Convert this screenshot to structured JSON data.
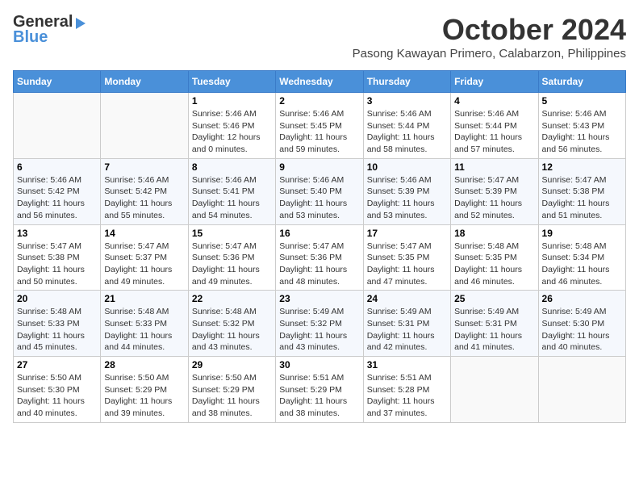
{
  "header": {
    "logo_general": "General",
    "logo_blue": "Blue",
    "month": "October 2024",
    "location": "Pasong Kawayan Primero, Calabarzon, Philippines"
  },
  "days_of_week": [
    "Sunday",
    "Monday",
    "Tuesday",
    "Wednesday",
    "Thursday",
    "Friday",
    "Saturday"
  ],
  "weeks": [
    [
      {
        "day": "",
        "info": ""
      },
      {
        "day": "",
        "info": ""
      },
      {
        "day": "1",
        "info": "Sunrise: 5:46 AM\nSunset: 5:46 PM\nDaylight: 12 hours\nand 0 minutes."
      },
      {
        "day": "2",
        "info": "Sunrise: 5:46 AM\nSunset: 5:45 PM\nDaylight: 11 hours\nand 59 minutes."
      },
      {
        "day": "3",
        "info": "Sunrise: 5:46 AM\nSunset: 5:44 PM\nDaylight: 11 hours\nand 58 minutes."
      },
      {
        "day": "4",
        "info": "Sunrise: 5:46 AM\nSunset: 5:44 PM\nDaylight: 11 hours\nand 57 minutes."
      },
      {
        "day": "5",
        "info": "Sunrise: 5:46 AM\nSunset: 5:43 PM\nDaylight: 11 hours\nand 56 minutes."
      }
    ],
    [
      {
        "day": "6",
        "info": "Sunrise: 5:46 AM\nSunset: 5:42 PM\nDaylight: 11 hours\nand 56 minutes."
      },
      {
        "day": "7",
        "info": "Sunrise: 5:46 AM\nSunset: 5:42 PM\nDaylight: 11 hours\nand 55 minutes."
      },
      {
        "day": "8",
        "info": "Sunrise: 5:46 AM\nSunset: 5:41 PM\nDaylight: 11 hours\nand 54 minutes."
      },
      {
        "day": "9",
        "info": "Sunrise: 5:46 AM\nSunset: 5:40 PM\nDaylight: 11 hours\nand 53 minutes."
      },
      {
        "day": "10",
        "info": "Sunrise: 5:46 AM\nSunset: 5:39 PM\nDaylight: 11 hours\nand 53 minutes."
      },
      {
        "day": "11",
        "info": "Sunrise: 5:47 AM\nSunset: 5:39 PM\nDaylight: 11 hours\nand 52 minutes."
      },
      {
        "day": "12",
        "info": "Sunrise: 5:47 AM\nSunset: 5:38 PM\nDaylight: 11 hours\nand 51 minutes."
      }
    ],
    [
      {
        "day": "13",
        "info": "Sunrise: 5:47 AM\nSunset: 5:38 PM\nDaylight: 11 hours\nand 50 minutes."
      },
      {
        "day": "14",
        "info": "Sunrise: 5:47 AM\nSunset: 5:37 PM\nDaylight: 11 hours\nand 49 minutes."
      },
      {
        "day": "15",
        "info": "Sunrise: 5:47 AM\nSunset: 5:36 PM\nDaylight: 11 hours\nand 49 minutes."
      },
      {
        "day": "16",
        "info": "Sunrise: 5:47 AM\nSunset: 5:36 PM\nDaylight: 11 hours\nand 48 minutes."
      },
      {
        "day": "17",
        "info": "Sunrise: 5:47 AM\nSunset: 5:35 PM\nDaylight: 11 hours\nand 47 minutes."
      },
      {
        "day": "18",
        "info": "Sunrise: 5:48 AM\nSunset: 5:35 PM\nDaylight: 11 hours\nand 46 minutes."
      },
      {
        "day": "19",
        "info": "Sunrise: 5:48 AM\nSunset: 5:34 PM\nDaylight: 11 hours\nand 46 minutes."
      }
    ],
    [
      {
        "day": "20",
        "info": "Sunrise: 5:48 AM\nSunset: 5:33 PM\nDaylight: 11 hours\nand 45 minutes."
      },
      {
        "day": "21",
        "info": "Sunrise: 5:48 AM\nSunset: 5:33 PM\nDaylight: 11 hours\nand 44 minutes."
      },
      {
        "day": "22",
        "info": "Sunrise: 5:48 AM\nSunset: 5:32 PM\nDaylight: 11 hours\nand 43 minutes."
      },
      {
        "day": "23",
        "info": "Sunrise: 5:49 AM\nSunset: 5:32 PM\nDaylight: 11 hours\nand 43 minutes."
      },
      {
        "day": "24",
        "info": "Sunrise: 5:49 AM\nSunset: 5:31 PM\nDaylight: 11 hours\nand 42 minutes."
      },
      {
        "day": "25",
        "info": "Sunrise: 5:49 AM\nSunset: 5:31 PM\nDaylight: 11 hours\nand 41 minutes."
      },
      {
        "day": "26",
        "info": "Sunrise: 5:49 AM\nSunset: 5:30 PM\nDaylight: 11 hours\nand 40 minutes."
      }
    ],
    [
      {
        "day": "27",
        "info": "Sunrise: 5:50 AM\nSunset: 5:30 PM\nDaylight: 11 hours\nand 40 minutes."
      },
      {
        "day": "28",
        "info": "Sunrise: 5:50 AM\nSunset: 5:29 PM\nDaylight: 11 hours\nand 39 minutes."
      },
      {
        "day": "29",
        "info": "Sunrise: 5:50 AM\nSunset: 5:29 PM\nDaylight: 11 hours\nand 38 minutes."
      },
      {
        "day": "30",
        "info": "Sunrise: 5:51 AM\nSunset: 5:29 PM\nDaylight: 11 hours\nand 38 minutes."
      },
      {
        "day": "31",
        "info": "Sunrise: 5:51 AM\nSunset: 5:28 PM\nDaylight: 11 hours\nand 37 minutes."
      },
      {
        "day": "",
        "info": ""
      },
      {
        "day": "",
        "info": ""
      }
    ]
  ]
}
